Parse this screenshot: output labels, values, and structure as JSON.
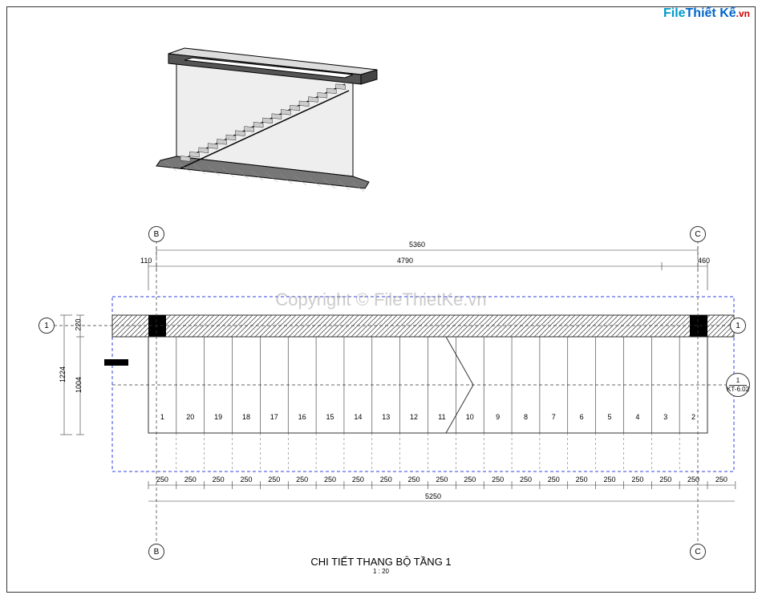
{
  "logo": {
    "file": "File",
    "tk": "Thiết Kế",
    "vn": ".vn"
  },
  "watermark": "Copyright © FileThietKe.vn",
  "title": {
    "main": "CHI TIẾT THANG BỘ TẦNG 1",
    "scale": "1 : 20"
  },
  "grid_letters": {
    "b": "B",
    "c": "C",
    "one": "1"
  },
  "detail_ref": {
    "num": "1",
    "sheet": "KT-6.02"
  },
  "dims_top": {
    "total": "5360",
    "left_off": "110",
    "mid": "4790",
    "right_off": "460"
  },
  "dims_left": {
    "total": "1224",
    "a": "220",
    "b": "1004"
  },
  "step_width": "250",
  "step_row_total": "5250",
  "steps": [
    "1",
    "20",
    "19",
    "18",
    "17",
    "16",
    "15",
    "14",
    "13",
    "12",
    "11",
    "10",
    "9",
    "8",
    "7",
    "6",
    "5",
    "4",
    "3",
    "2"
  ],
  "step_count": 20
}
